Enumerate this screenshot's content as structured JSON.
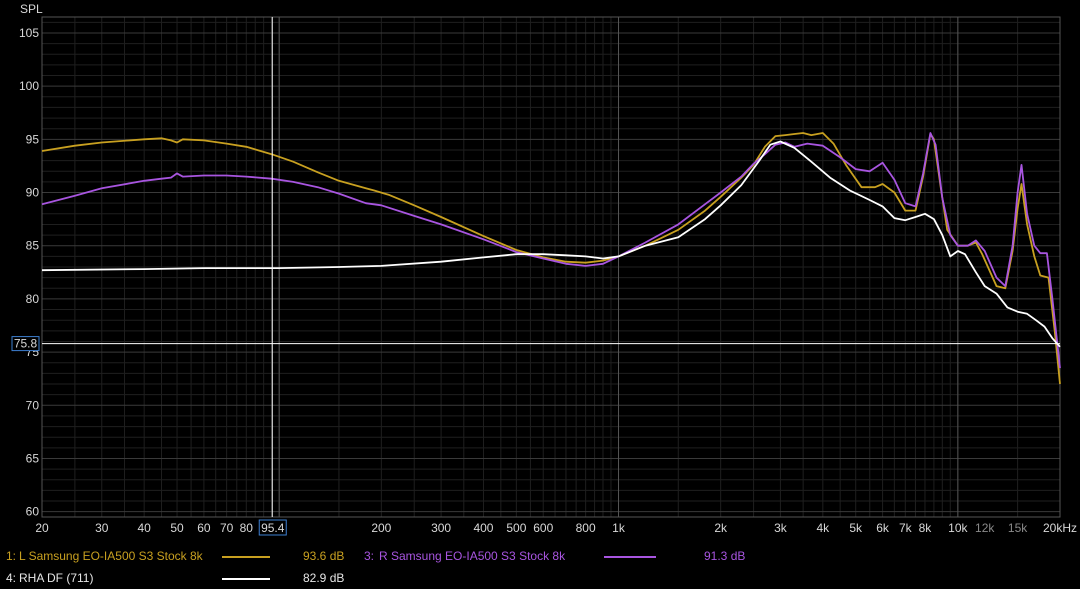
{
  "chart_data": {
    "type": "line",
    "ylabel": "SPL",
    "xscale": "log",
    "xlim": [
      20,
      20000
    ],
    "ylim": [
      59.5,
      106.5
    ],
    "y_ticks": [
      60,
      65,
      70,
      75,
      80,
      85,
      90,
      95,
      100,
      105
    ],
    "x_ticks": [
      {
        "v": 20,
        "label": "20",
        "minor": false
      },
      {
        "v": 30,
        "label": "30",
        "minor": false
      },
      {
        "v": 40,
        "label": "40",
        "minor": false
      },
      {
        "v": 50,
        "label": "50",
        "minor": false
      },
      {
        "v": 60,
        "label": "60",
        "minor": false
      },
      {
        "v": 70,
        "label": "70",
        "minor": false
      },
      {
        "v": 80,
        "label": "80",
        "minor": false
      },
      {
        "v": 200,
        "label": "200",
        "minor": false
      },
      {
        "v": 300,
        "label": "300",
        "minor": false
      },
      {
        "v": 400,
        "label": "400",
        "minor": false
      },
      {
        "v": 500,
        "label": "500",
        "minor": false
      },
      {
        "v": 600,
        "label": "600",
        "minor": false
      },
      {
        "v": 800,
        "label": "800",
        "minor": false
      },
      {
        "v": 1000,
        "label": "1k",
        "minor": false
      },
      {
        "v": 2000,
        "label": "2k",
        "minor": false
      },
      {
        "v": 3000,
        "label": "3k",
        "minor": false
      },
      {
        "v": 4000,
        "label": "4k",
        "minor": false
      },
      {
        "v": 5000,
        "label": "5k",
        "minor": false
      },
      {
        "v": 6000,
        "label": "6k",
        "minor": false
      },
      {
        "v": 7000,
        "label": "7k",
        "minor": false
      },
      {
        "v": 8000,
        "label": "8k",
        "minor": false
      },
      {
        "v": 10000,
        "label": "10k",
        "minor": false
      },
      {
        "v": 12000,
        "label": "12k",
        "minor": true
      },
      {
        "v": 15000,
        "label": "15k",
        "minor": true
      },
      {
        "v": 20000,
        "label": "20kHz",
        "minor": false
      }
    ],
    "cursor": {
      "x": 95.4,
      "x_label": "95.4",
      "y": 75.8,
      "y_label": "75.8"
    },
    "grid": true,
    "colors": {
      "background": "#000000",
      "grid_major": "#3a3a3a",
      "grid_minor": "#1f1f1f",
      "cursor": "#ffffff",
      "cursor_box": "#3d7fd1"
    },
    "series": [
      {
        "name": "L Samsung EO-IA500 S3 Stock 8k",
        "legend_id": "1:",
        "legend_value": "93.6 dB",
        "color": "#c8a020",
        "points": [
          [
            20,
            93.9
          ],
          [
            25,
            94.4
          ],
          [
            30,
            94.7
          ],
          [
            40,
            95.0
          ],
          [
            45,
            95.1
          ],
          [
            48,
            94.9
          ],
          [
            50,
            94.7
          ],
          [
            52,
            95.0
          ],
          [
            60,
            94.9
          ],
          [
            70,
            94.6
          ],
          [
            80,
            94.3
          ],
          [
            95,
            93.6
          ],
          [
            110,
            92.9
          ],
          [
            130,
            91.9
          ],
          [
            150,
            91.1
          ],
          [
            180,
            90.4
          ],
          [
            190,
            90.2
          ],
          [
            210,
            89.8
          ],
          [
            250,
            88.8
          ],
          [
            300,
            87.7
          ],
          [
            400,
            85.9
          ],
          [
            500,
            84.6
          ],
          [
            600,
            83.9
          ],
          [
            700,
            83.5
          ],
          [
            800,
            83.4
          ],
          [
            900,
            83.6
          ],
          [
            1000,
            84.0
          ],
          [
            1200,
            85.0
          ],
          [
            1500,
            86.5
          ],
          [
            1800,
            88.3
          ],
          [
            2000,
            89.6
          ],
          [
            2300,
            91.4
          ],
          [
            2500,
            92.6
          ],
          [
            2700,
            94.3
          ],
          [
            2900,
            95.3
          ],
          [
            3100,
            95.4
          ],
          [
            3300,
            95.5
          ],
          [
            3500,
            95.6
          ],
          [
            3700,
            95.4
          ],
          [
            4000,
            95.6
          ],
          [
            4300,
            94.6
          ],
          [
            4700,
            92.5
          ],
          [
            5200,
            90.5
          ],
          [
            5700,
            90.5
          ],
          [
            6000,
            90.8
          ],
          [
            6500,
            90.0
          ],
          [
            7000,
            88.3
          ],
          [
            7500,
            88.3
          ],
          [
            7900,
            91.5
          ],
          [
            8300,
            95.5
          ],
          [
            8500,
            95.0
          ],
          [
            8900,
            90.5
          ],
          [
            9300,
            86.5
          ],
          [
            10000,
            85.0
          ],
          [
            10700,
            85.0
          ],
          [
            11300,
            85.3
          ],
          [
            11800,
            84.2
          ],
          [
            13000,
            81.2
          ],
          [
            13800,
            81.0
          ],
          [
            14500,
            84.5
          ],
          [
            15000,
            88.5
          ],
          [
            15400,
            90.8
          ],
          [
            16000,
            87.0
          ],
          [
            16800,
            84.0
          ],
          [
            17500,
            82.2
          ],
          [
            18500,
            82.0
          ],
          [
            19300,
            77.0
          ],
          [
            20000,
            72.0
          ]
        ]
      },
      {
        "name": "R Samsung EO-IA500 S3 Stock 8k",
        "legend_id": "3:",
        "legend_value": "91.3 dB",
        "color": "#a855e0",
        "points": [
          [
            20,
            88.9
          ],
          [
            25,
            89.7
          ],
          [
            30,
            90.4
          ],
          [
            40,
            91.1
          ],
          [
            45,
            91.3
          ],
          [
            48,
            91.4
          ],
          [
            50,
            91.8
          ],
          [
            52,
            91.5
          ],
          [
            60,
            91.6
          ],
          [
            70,
            91.6
          ],
          [
            80,
            91.5
          ],
          [
            95,
            91.3
          ],
          [
            110,
            91.0
          ],
          [
            130,
            90.5
          ],
          [
            150,
            89.9
          ],
          [
            180,
            89.0
          ],
          [
            200,
            88.8
          ],
          [
            250,
            87.8
          ],
          [
            300,
            87.0
          ],
          [
            400,
            85.6
          ],
          [
            500,
            84.4
          ],
          [
            600,
            83.8
          ],
          [
            700,
            83.3
          ],
          [
            800,
            83.1
          ],
          [
            900,
            83.3
          ],
          [
            1000,
            84.0
          ],
          [
            1200,
            85.3
          ],
          [
            1500,
            87.0
          ],
          [
            1800,
            88.9
          ],
          [
            2000,
            90.0
          ],
          [
            2300,
            91.5
          ],
          [
            2500,
            92.7
          ],
          [
            2700,
            93.6
          ],
          [
            2900,
            94.5
          ],
          [
            3100,
            94.7
          ],
          [
            3300,
            94.3
          ],
          [
            3600,
            94.6
          ],
          [
            4000,
            94.4
          ],
          [
            4500,
            93.3
          ],
          [
            5000,
            92.2
          ],
          [
            5500,
            92.0
          ],
          [
            6000,
            92.8
          ],
          [
            6500,
            91.2
          ],
          [
            7000,
            89.0
          ],
          [
            7500,
            88.7
          ],
          [
            7900,
            91.8
          ],
          [
            8300,
            95.6
          ],
          [
            8600,
            94.5
          ],
          [
            9000,
            89.5
          ],
          [
            9500,
            86.0
          ],
          [
            10000,
            85.0
          ],
          [
            10700,
            85.0
          ],
          [
            11300,
            85.5
          ],
          [
            12000,
            84.5
          ],
          [
            13000,
            82.0
          ],
          [
            13800,
            81.2
          ],
          [
            14500,
            85.0
          ],
          [
            15000,
            90.0
          ],
          [
            15400,
            92.6
          ],
          [
            16000,
            88.0
          ],
          [
            16800,
            85.0
          ],
          [
            17500,
            84.3
          ],
          [
            18300,
            84.3
          ],
          [
            19000,
            80.0
          ],
          [
            20000,
            73.5
          ]
        ]
      },
      {
        "name": "RHA DF (711)",
        "legend_id": "4:",
        "legend_value": "82.9 dB",
        "color": "#ffffff",
        "points": [
          [
            20,
            82.7
          ],
          [
            40,
            82.8
          ],
          [
            60,
            82.9
          ],
          [
            100,
            82.9
          ],
          [
            150,
            83.0
          ],
          [
            200,
            83.1
          ],
          [
            300,
            83.5
          ],
          [
            400,
            83.9
          ],
          [
            500,
            84.2
          ],
          [
            600,
            84.2
          ],
          [
            700,
            84.1
          ],
          [
            800,
            84.0
          ],
          [
            900,
            83.8
          ],
          [
            1000,
            84.0
          ],
          [
            1200,
            85.0
          ],
          [
            1500,
            85.8
          ],
          [
            1800,
            87.5
          ],
          [
            2000,
            88.8
          ],
          [
            2300,
            90.7
          ],
          [
            2600,
            93.0
          ],
          [
            2800,
            94.5
          ],
          [
            3000,
            94.8
          ],
          [
            3300,
            94.2
          ],
          [
            3700,
            92.9
          ],
          [
            4200,
            91.4
          ],
          [
            4800,
            90.2
          ],
          [
            5500,
            89.3
          ],
          [
            6000,
            88.7
          ],
          [
            6500,
            87.6
          ],
          [
            7000,
            87.4
          ],
          [
            7500,
            87.7
          ],
          [
            8000,
            88.0
          ],
          [
            8500,
            87.5
          ],
          [
            9000,
            86.0
          ],
          [
            9500,
            84.0
          ],
          [
            10000,
            84.5
          ],
          [
            10500,
            84.2
          ],
          [
            11300,
            82.5
          ],
          [
            12000,
            81.2
          ],
          [
            13000,
            80.5
          ],
          [
            14000,
            79.2
          ],
          [
            15000,
            78.8
          ],
          [
            16000,
            78.6
          ],
          [
            17000,
            78.0
          ],
          [
            18000,
            77.4
          ],
          [
            19000,
            76.3
          ],
          [
            20000,
            75.5
          ]
        ]
      }
    ]
  }
}
